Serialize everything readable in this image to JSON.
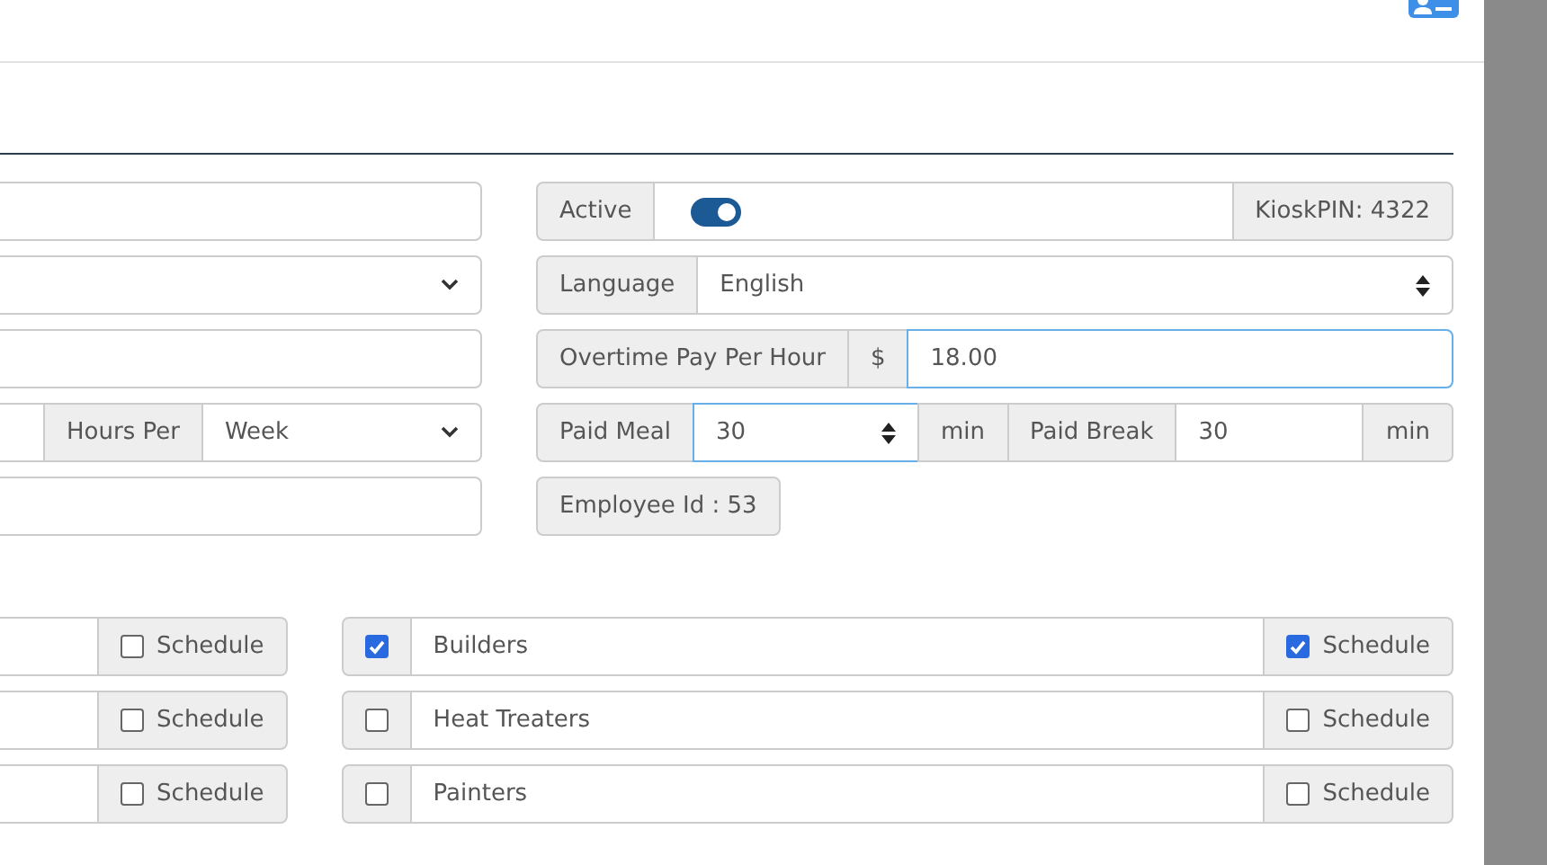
{
  "left_fields": [
    {
      "kind": "text"
    },
    {
      "kind": "select"
    },
    {
      "kind": "text"
    },
    {
      "kind": "hours",
      "label": "Hours Per",
      "value": "Week"
    },
    {
      "kind": "text"
    }
  ],
  "active": {
    "label": "Active",
    "on": true,
    "kiosk_pin": "KioskPIN: 4322"
  },
  "language": {
    "label": "Language",
    "value": "English"
  },
  "overtime": {
    "label": "Overtime Pay Per Hour",
    "currency": "$",
    "value": "18.00"
  },
  "paid_meal": {
    "label": "Paid Meal",
    "value": "30",
    "unit": "min"
  },
  "paid_break": {
    "label": "Paid Break",
    "value": "30",
    "unit": "min"
  },
  "employee_id": "Employee Id : 53",
  "left_schedules": [
    {
      "label": "Schedule",
      "checked": false
    },
    {
      "label": "Schedule",
      "checked": false
    },
    {
      "label": "Schedule",
      "checked": false
    }
  ],
  "groups": [
    {
      "name": "Builders",
      "checked": true,
      "schedule_label": "Schedule",
      "schedule": true
    },
    {
      "name": "Heat Treaters",
      "checked": false,
      "schedule_label": "Schedule",
      "schedule": false
    },
    {
      "name": "Painters",
      "checked": false,
      "schedule_label": "Schedule",
      "schedule": false
    }
  ]
}
